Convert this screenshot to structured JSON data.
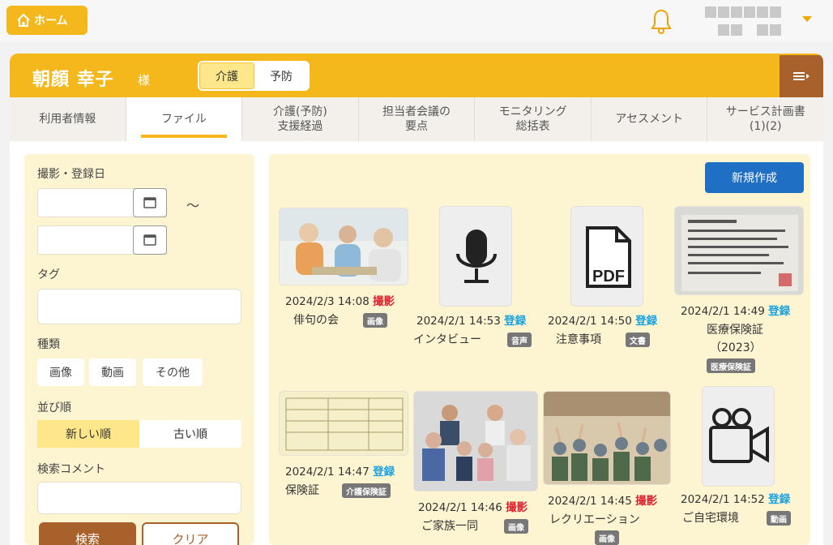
{
  "header": {
    "home_label": "ホーム",
    "icons": {
      "home": "home-icon",
      "bell": "bell-icon",
      "menu": "menu-icon"
    },
    "accent": "#f5b81c",
    "brown": "#a9612b"
  },
  "client": {
    "name": "朝顔 幸子",
    "honorific": "様",
    "mode_options": [
      "介護",
      "予防"
    ],
    "mode_selected": "介護"
  },
  "tabs": [
    {
      "l1": "利用者情報",
      "l2": ""
    },
    {
      "l1": "ファイル",
      "l2": ""
    },
    {
      "l1": "介護(予防)",
      "l2": "支援経過"
    },
    {
      "l1": "担当者会議の",
      "l2": "要点"
    },
    {
      "l1": "モニタリング",
      "l2": "総括表"
    },
    {
      "l1": "アセスメント",
      "l2": ""
    },
    {
      "l1": "サービス計画書",
      "l2": "(1)(2)"
    }
  ],
  "active_tab": "ファイル",
  "filter": {
    "date_label": "撮影・登録日",
    "range_sep": "～",
    "tag_label": "タグ",
    "type_label": "種類",
    "types": [
      "画像",
      "動画",
      "その他"
    ],
    "sort_label": "並び順",
    "sort_options": [
      "新しい順",
      "古い順"
    ],
    "sort_selected": "新しい順",
    "comment_label": "検索コメント",
    "search_label": "検索",
    "clear_label": "クリア"
  },
  "new_button": "新規作成",
  "files": [
    {
      "date": "2024/2/3 14:08",
      "kind": "撮影",
      "title": "俳句の会",
      "tag": "画像",
      "thumb": "photo-seniors"
    },
    {
      "date": "2024/2/1 14:53",
      "kind": "登録",
      "title": "インタビュー",
      "tag": "音声",
      "thumb": "microphone-icon"
    },
    {
      "date": "2024/2/1 14:50",
      "kind": "登録",
      "title": "注意事項",
      "tag": "文書",
      "thumb": "pdf-icon",
      "icon_text": "PDF"
    },
    {
      "date": "2024/2/1 14:49",
      "kind": "登録",
      "title": "医療保険証",
      "title2": "（2023）",
      "tag": "医療保険証",
      "thumb": "doc-card"
    },
    {
      "date": "2024/2/1 14:47",
      "kind": "登録",
      "title": "保険証",
      "tag": "介護保険証",
      "thumb": "doc-yellow"
    },
    {
      "date": "2024/2/1 14:46",
      "kind": "撮影",
      "title": "ご家族一同",
      "tag": "画像",
      "thumb": "photo-family"
    },
    {
      "date": "2024/2/1 14:45",
      "kind": "撮影",
      "title": "レクリエーション",
      "tag": "画像",
      "thumb": "photo-recreation"
    },
    {
      "date": "2024/2/1 14:52",
      "kind": "登録",
      "title": "ご自宅環境",
      "tag": "動画",
      "thumb": "video-camera-icon"
    }
  ],
  "colors": {
    "shot": "#e0202e",
    "registered": "#1aa3e0"
  }
}
